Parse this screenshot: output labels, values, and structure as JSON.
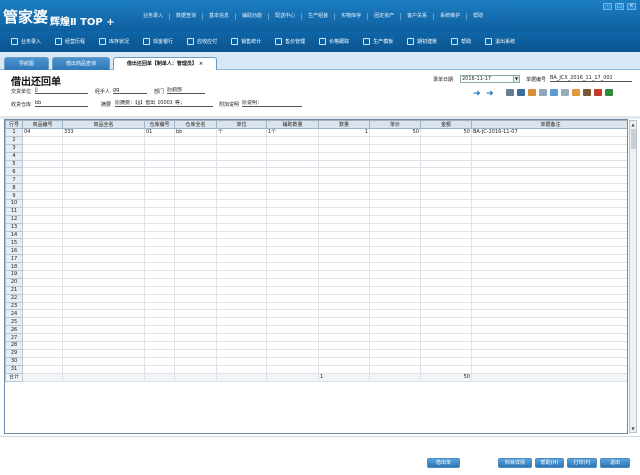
{
  "app": {
    "logo": "管家婆",
    "edition": "辉煌Ⅱ TOP +",
    "top_menu": [
      "业务录入",
      "数据查询",
      "基本信息",
      "辅助功能",
      "配送中心",
      "生产组装",
      "实物库存",
      "固定资产",
      "客户关系",
      "系统维护",
      "帮助"
    ]
  },
  "toolbar": [
    {
      "label": "业务录入",
      "icon": "entry-icon"
    },
    {
      "label": "经营历程",
      "icon": "history-icon"
    },
    {
      "label": "库存状况",
      "icon": "stock-icon"
    },
    {
      "label": "现金银行",
      "icon": "cash-icon"
    },
    {
      "label": "应收应付",
      "icon": "receivable-icon"
    },
    {
      "label": "销售统计",
      "icon": "stats-icon"
    },
    {
      "label": "售价管理",
      "icon": "price-icon"
    },
    {
      "label": "价格跟踪",
      "icon": "track-icon"
    },
    {
      "label": "生产模板",
      "icon": "template-icon"
    },
    {
      "label": "期初建账",
      "icon": "ledger-icon"
    },
    {
      "label": "帮助",
      "icon": "help-icon"
    },
    {
      "label": "退出系统",
      "icon": "exit-icon"
    }
  ],
  "tabs": [
    {
      "label": "导航图"
    },
    {
      "label": "借出商品查询"
    },
    {
      "label": "借出还回单【制单人：管理员】"
    }
  ],
  "form": {
    "title": "借出还回单",
    "date_label": "录单日期",
    "date_value": "2016-11-17",
    "order_no_label": "单据编号",
    "order_no_value": "BA_JCX_2016_11_17_001",
    "supplier_label": "交货单位",
    "supplier_value": "jj",
    "handler_label": "经手人",
    "handler_value": "gg",
    "dept_label": "部门",
    "dept_value": "后勤部",
    "warehouse_label": "收货仓库",
    "warehouse_value": "bb",
    "summary_label": "摘要",
    "summary_value": "原摘要：【jj】借出【000】等；",
    "note_label": "附加说明",
    "note_value": "原说明："
  },
  "grid": {
    "columns": [
      "行号",
      "商品编号",
      "商品全名",
      "仓库编号",
      "仓库全名",
      "单位",
      "辅助数量",
      "数量",
      "单价",
      "金额",
      "单据备注"
    ],
    "rows": [
      [
        "1",
        "04",
        "333",
        "01",
        "bb",
        "个",
        "1个",
        "1",
        "50",
        "50",
        "BA-JC-2016-11-07"
      ]
    ],
    "total_label": "合计",
    "total_quantity": "1",
    "total_amount": "50",
    "row_count": 31
  },
  "buttons": {
    "borrow_out": "借出单",
    "subject_detail": "科目详情",
    "help": "帮助(H)",
    "print": "打印(P)",
    "exit": "退出"
  },
  "colors": {
    "title_bar": "#1d7fc3",
    "toolbar": "#0f66a8",
    "button": "#2c75b5"
  }
}
